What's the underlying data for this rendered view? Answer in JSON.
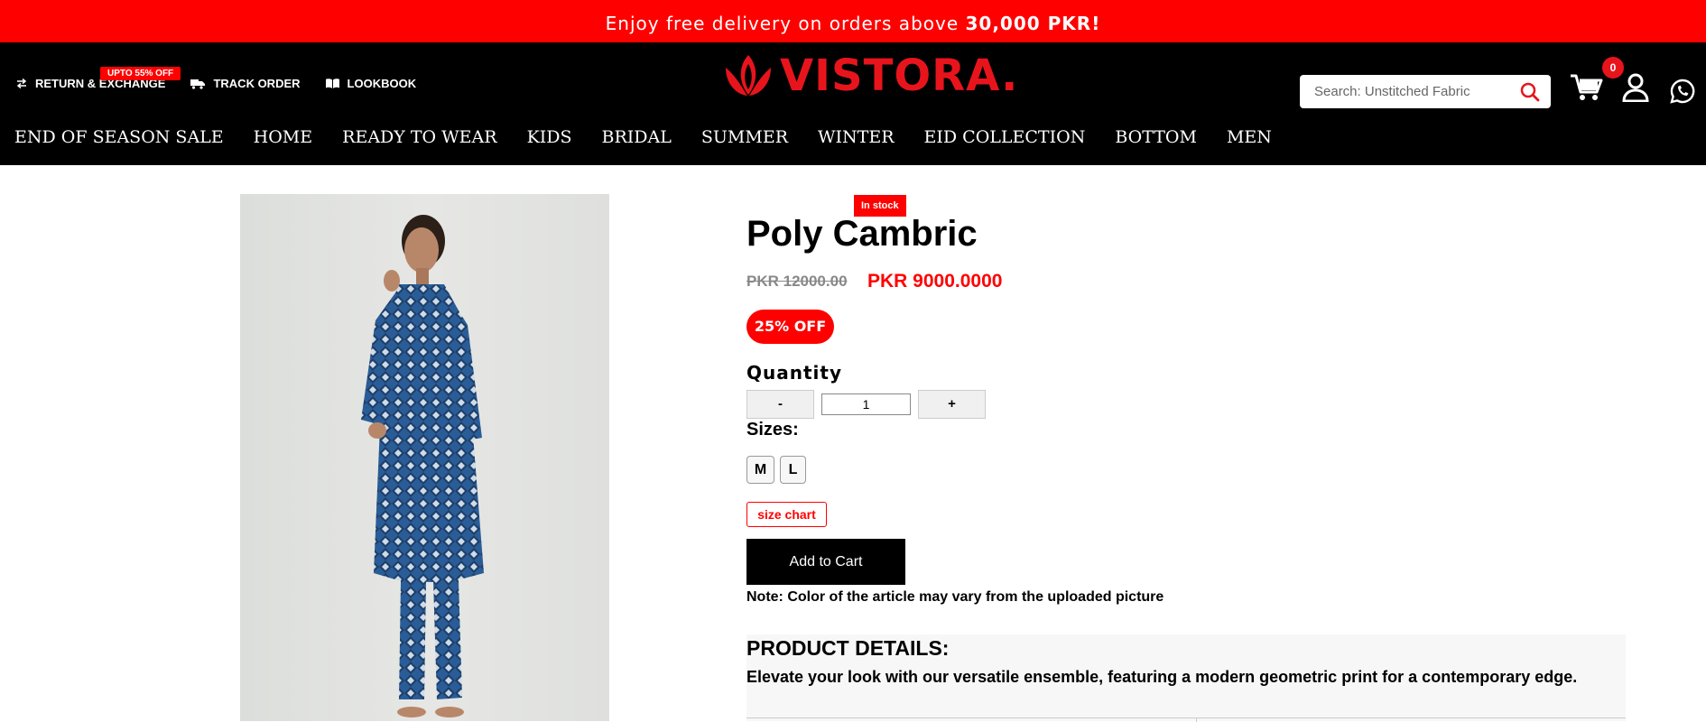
{
  "announcement": {
    "prefix": "Enjoy free delivery on orders above ",
    "amount": "30,000 PKR!"
  },
  "header": {
    "utility_links": [
      {
        "label": "RETURN & EXCHANGE",
        "icon": "exchange-arrows-icon"
      },
      {
        "label": "TRACK ORDER",
        "icon": "truck-icon"
      },
      {
        "label": "LOOKBOOK",
        "icon": "book-icon"
      }
    ],
    "logo_text": "VISTORA.",
    "search": {
      "placeholder": "Search: Unstitched Fabric"
    },
    "cart_count": "0",
    "nav": [
      {
        "label": "END OF SEASON SALE"
      },
      {
        "label": "HOME"
      },
      {
        "label": "READY TO WEAR"
      },
      {
        "label": "KIDS"
      },
      {
        "label": "BRIDAL"
      },
      {
        "label": "SUMMER"
      },
      {
        "label": "WINTER"
      },
      {
        "label": "EID COLLECTION"
      },
      {
        "label": "BOTTOM"
      },
      {
        "label": "MEN"
      }
    ],
    "nav_badge": "UPTO 55% OFF"
  },
  "colors": {
    "brand_red": "#e8141c",
    "accent_red": "#ff0000",
    "header_bg": "#000000"
  },
  "product": {
    "stock_status": "In stock",
    "title": "Poly Cambric",
    "old_price": "PKR 12000.00",
    "new_price": "PKR 9000.0000",
    "discount_badge": "25% OFF",
    "quantity_label": "Quantity",
    "quantity_minus": "-",
    "quantity_value": "1",
    "quantity_plus": "+",
    "sizes_label": "Sizes:",
    "sizes": [
      "M",
      "L"
    ],
    "size_chart_label": "size chart",
    "add_to_cart_label": "Add to Cart",
    "note": "Note: Color of the article may vary from the uploaded picture",
    "details_title": "PRODUCT DETAILS:",
    "details_text": "Elevate your look with our versatile ensemble, featuring a modern geometric print for a contemporary edge."
  }
}
